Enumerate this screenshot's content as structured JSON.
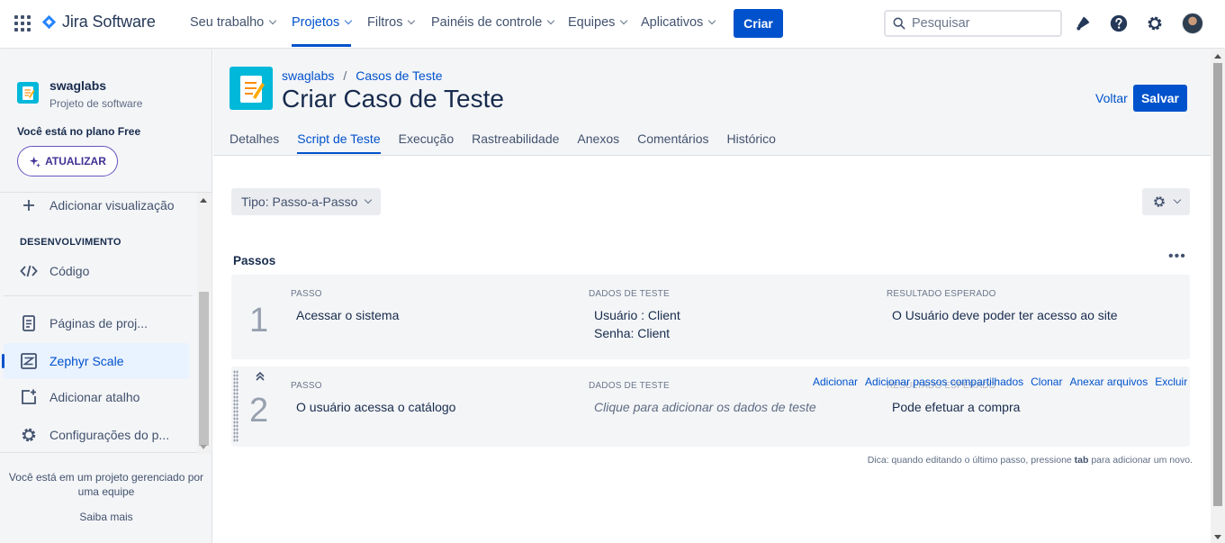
{
  "topnav": {
    "product": "Jira Software",
    "items": [
      {
        "label": "Seu trabalho",
        "active": false
      },
      {
        "label": "Projetos",
        "active": true
      },
      {
        "label": "Filtros",
        "active": false
      },
      {
        "label": "Painéis de controle",
        "active": false
      },
      {
        "label": "Equipes",
        "active": false
      },
      {
        "label": "Aplicativos",
        "active": false
      }
    ],
    "create_label": "Criar",
    "search_placeholder": "Pesquisar"
  },
  "sidebar": {
    "project_name": "swaglabs",
    "project_type": "Projeto de software",
    "plan_text": "Você está no plano Free",
    "upgrade_label": "ATUALIZAR",
    "add_view": "Adicionar visualização",
    "section_dev": "DESENVOLVIMENTO",
    "code": "Código",
    "pages": "Páginas de proj...",
    "zephyr": "Zephyr Scale",
    "add_shortcut": "Adicionar atalho",
    "settings": "Configurações do p...",
    "footer_text": "Você está em um projeto gerenciado por uma equipe",
    "learn_more": "Saiba mais"
  },
  "header": {
    "breadcrumb": [
      "swaglabs",
      "Casos de Teste"
    ],
    "title": "Criar Caso de Teste",
    "back_label": "Voltar",
    "save_label": "Salvar",
    "tabs": [
      {
        "label": "Detalhes",
        "active": false
      },
      {
        "label": "Script de Teste",
        "active": true
      },
      {
        "label": "Execução",
        "active": false
      },
      {
        "label": "Rastreabilidade",
        "active": false
      },
      {
        "label": "Anexos",
        "active": false
      },
      {
        "label": "Comentários",
        "active": false
      },
      {
        "label": "Histórico",
        "active": false
      }
    ]
  },
  "script": {
    "type_label": "Tipo: Passo-a-Passo",
    "steps_title": "Passos",
    "col_step": "PASSO",
    "col_data": "DADOS DE TESTE",
    "col_result": "RESULTADO ESPERADO",
    "steps": [
      {
        "number": "1",
        "step": "Acessar o sistema",
        "data_line1": "Usuário : Client",
        "data_line2": "Senha: Client",
        "result": "O Usuário deve poder ter acesso ao site"
      },
      {
        "number": "2",
        "step": "O usuário acessa o catálogo",
        "data_placeholder": "Clique para adicionar os dados de teste",
        "result": "Pode efetuar a compra"
      }
    ],
    "actions": [
      "Adicionar",
      "Adicionar passos compartilhados",
      "Clonar",
      "Anexar arquivos",
      "Excluir"
    ],
    "hint_pre": "Dica: quando editando o último passo, pressione",
    "hint_key": "tab",
    "hint_post": "para adicionar um novo."
  },
  "colors": {
    "accent": "#0052cc",
    "sidebar_bg": "#f4f5f7",
    "project_icon": "#00b8d9",
    "upgrade": "#6554c0"
  }
}
